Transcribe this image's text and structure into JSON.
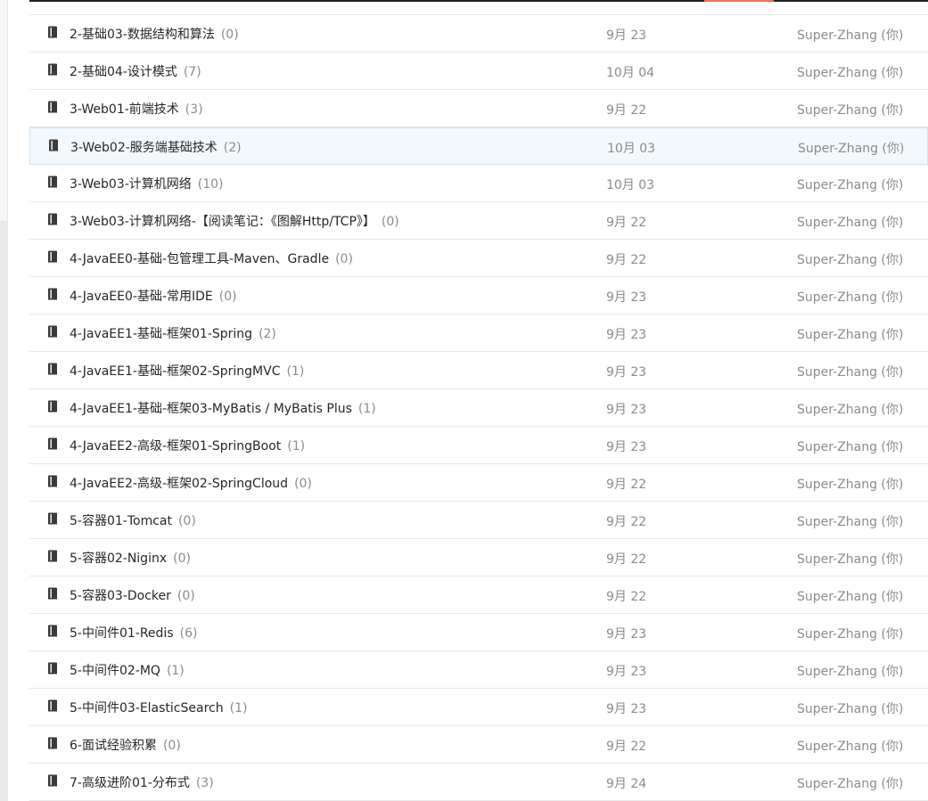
{
  "colors": {
    "text": "#262626",
    "muted": "#8c8c8c",
    "highlight_bg": "#f3f8fd",
    "highlight_border": "#cfe3f5",
    "divider": "#e8e8e8"
  },
  "rows": [
    {
      "name": "2-基础03-数据结构和算法",
      "count": "(0)",
      "date": "9月 23",
      "owner": "Super-Zhang (你)",
      "icon": "book-icon"
    },
    {
      "name": "2-基础04-设计模式",
      "count": "(7)",
      "date": "10月 04",
      "owner": "Super-Zhang (你)",
      "icon": "book-icon"
    },
    {
      "name": "3-Web01-前端技术",
      "count": "(3)",
      "date": "9月 22",
      "owner": "Super-Zhang (你)",
      "icon": "book-icon"
    },
    {
      "name": "3-Web02-服务端基础技术",
      "count": "(2)",
      "date": "10月 03",
      "owner": "Super-Zhang (你)",
      "icon": "book-icon",
      "highlighted": true
    },
    {
      "name": "3-Web03-计算机网络",
      "count": "(10)",
      "date": "10月 03",
      "owner": "Super-Zhang (你)",
      "icon": "book-icon"
    },
    {
      "name": "3-Web03-计算机网络-【阅读笔记：《图解Http/TCP》】",
      "count": "(0)",
      "date": "9月 22",
      "owner": "Super-Zhang (你)",
      "icon": "book-icon"
    },
    {
      "name": "4-JavaEE0-基础-包管理工具-Maven、Gradle",
      "count": "(0)",
      "date": "9月 22",
      "owner": "Super-Zhang (你)",
      "icon": "book-icon"
    },
    {
      "name": "4-JavaEE0-基础-常用IDE",
      "count": "(0)",
      "date": "9月 23",
      "owner": "Super-Zhang (你)",
      "icon": "book-icon"
    },
    {
      "name": "4-JavaEE1-基础-框架01-Spring",
      "count": "(2)",
      "date": "9月 23",
      "owner": "Super-Zhang (你)",
      "icon": "book-icon"
    },
    {
      "name": "4-JavaEE1-基础-框架02-SpringMVC",
      "count": "(1)",
      "date": "9月 23",
      "owner": "Super-Zhang (你)",
      "icon": "book-icon"
    },
    {
      "name": "4-JavaEE1-基础-框架03-MyBatis / MyBatis Plus",
      "count": "(1)",
      "date": "9月 23",
      "owner": "Super-Zhang (你)",
      "icon": "book-icon"
    },
    {
      "name": "4-JavaEE2-高级-框架01-SpringBoot",
      "count": "(1)",
      "date": "9月 23",
      "owner": "Super-Zhang (你)",
      "icon": "book-icon"
    },
    {
      "name": "4-JavaEE2-高级-框架02-SpringCloud",
      "count": "(0)",
      "date": "9月 22",
      "owner": "Super-Zhang (你)",
      "icon": "book-icon"
    },
    {
      "name": "5-容器01-Tomcat",
      "count": "(0)",
      "date": "9月 22",
      "owner": "Super-Zhang (你)",
      "icon": "book-icon"
    },
    {
      "name": "5-容器02-Niginx",
      "count": "(0)",
      "date": "9月 22",
      "owner": "Super-Zhang (你)",
      "icon": "book-icon"
    },
    {
      "name": "5-容器03-Docker",
      "count": "(0)",
      "date": "9月 22",
      "owner": "Super-Zhang (你)",
      "icon": "book-icon"
    },
    {
      "name": "5-中间件01-Redis",
      "count": "(6)",
      "date": "9月 23",
      "owner": "Super-Zhang (你)",
      "icon": "book-icon"
    },
    {
      "name": "5-中间件02-MQ",
      "count": "(1)",
      "date": "9月 23",
      "owner": "Super-Zhang (你)",
      "icon": "book-icon"
    },
    {
      "name": "5-中间件03-ElasticSearch",
      "count": "(1)",
      "date": "9月 23",
      "owner": "Super-Zhang (你)",
      "icon": "book-icon"
    },
    {
      "name": "6-面试经验积累",
      "count": "(0)",
      "date": "9月 22",
      "owner": "Super-Zhang (你)",
      "icon": "book-icon"
    },
    {
      "name": "7-高级进阶01-分布式",
      "count": "(3)",
      "date": "9月 24",
      "owner": "Super-Zhang (你)",
      "icon": "book-icon"
    }
  ]
}
